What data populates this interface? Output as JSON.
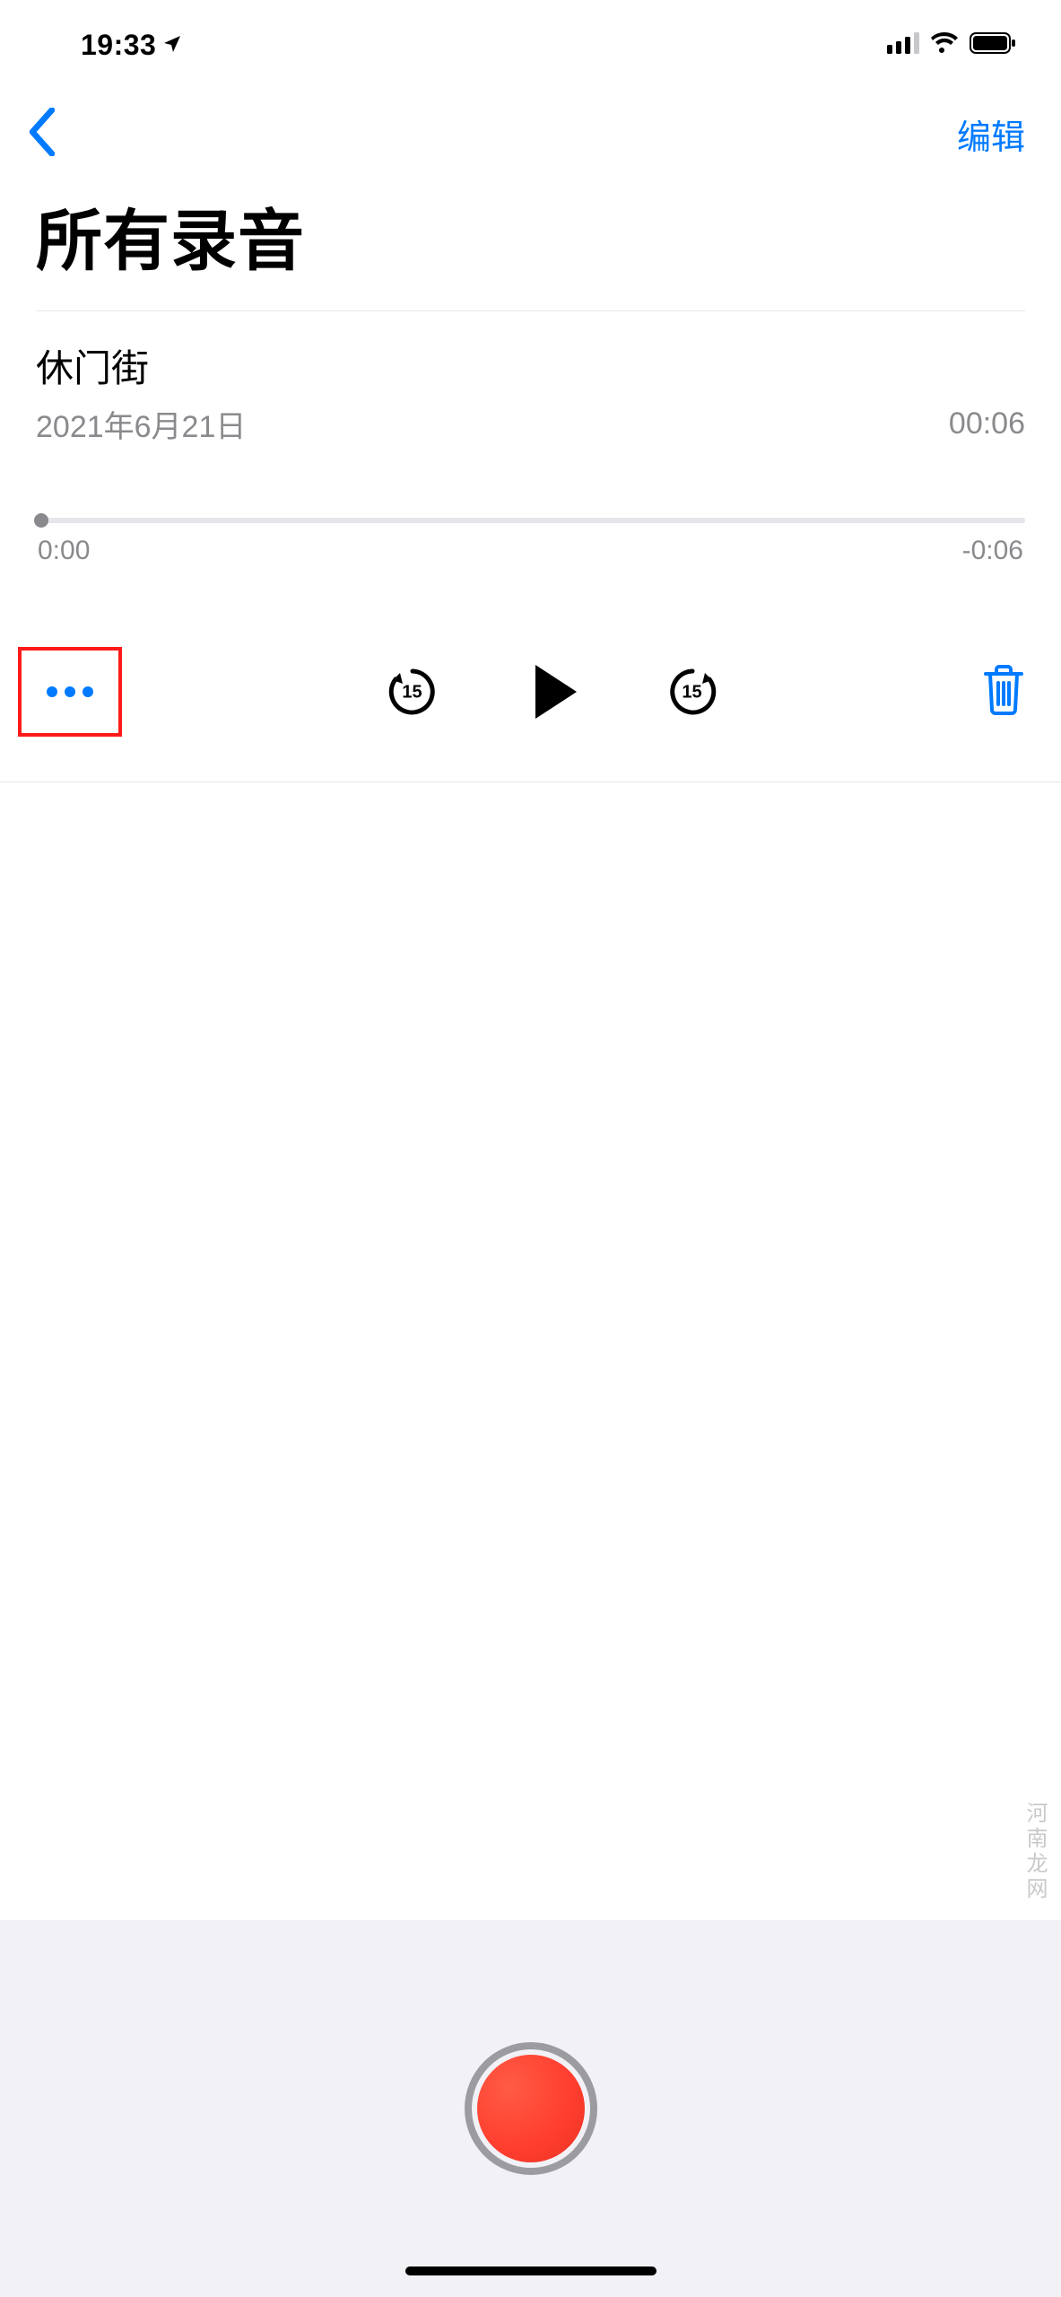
{
  "status_bar": {
    "time": "19:33",
    "location_icon": "location-arrow",
    "signal_icon": "cellular-signal",
    "wifi_icon": "wifi",
    "battery_icon": "battery-full"
  },
  "nav": {
    "back_icon": "chevron-left",
    "edit_label": "编辑"
  },
  "page": {
    "title": "所有录音"
  },
  "recording": {
    "title": "休门街",
    "date": "2021年6月21日",
    "duration": "00:06",
    "elapsed": "0:00",
    "remaining": "-0:06"
  },
  "controls": {
    "more_icon": "more-horizontal",
    "skip_back_seconds": "15",
    "skip_forward_seconds": "15",
    "play_icon": "play",
    "trash_icon": "trash"
  },
  "footer": {
    "record_icon": "record"
  },
  "watermark": "河南龙网"
}
